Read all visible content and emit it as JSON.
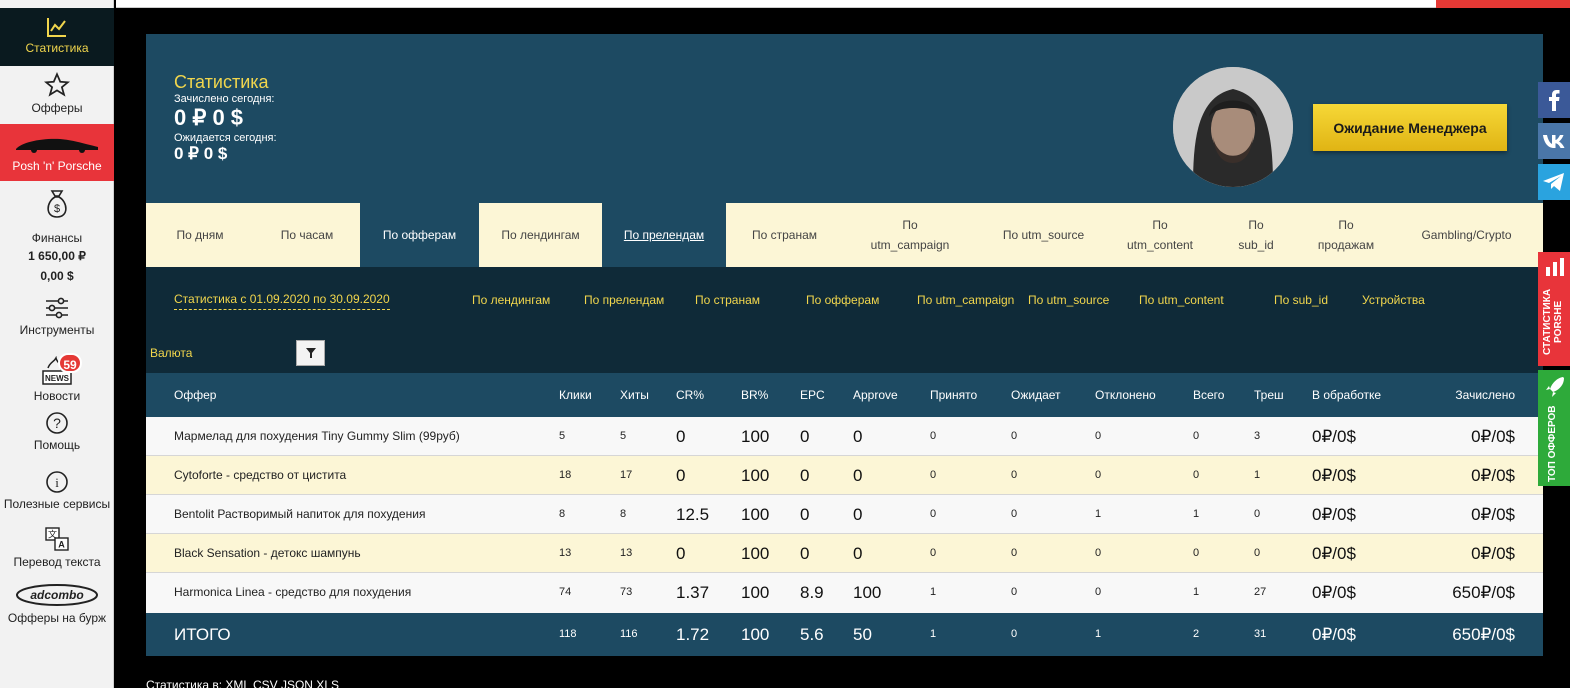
{
  "sidebar": {
    "items": [
      {
        "label": "Статистика",
        "icon": "chart-line-icon"
      },
      {
        "label": "Офферы",
        "icon": "star-icon"
      },
      {
        "label": "Posh 'n' Porsche",
        "icon": "sports-car-icon"
      },
      {
        "label": "Финансы",
        "icon": "money-bag-icon",
        "amount_rub": "1 650,00 ₽",
        "amount_usd": "0,00 $"
      },
      {
        "label": "Инструменты",
        "icon": "sliders-icon"
      },
      {
        "label": "Новости",
        "icon": "news-icon",
        "badge": "59",
        "badge_text": "NEWS"
      },
      {
        "label": "Помощь",
        "icon": "question-icon"
      },
      {
        "label": "Полезные сервисы",
        "icon": "info-icon"
      },
      {
        "label": "Перевод текста",
        "icon": "translate-icon"
      },
      {
        "label": "Офферы на бурж",
        "icon": "adcombo-logo-icon",
        "logo_text": "adcombo"
      }
    ]
  },
  "header": {
    "title": "Статистика",
    "credited_label": "Зачислено сегодня:",
    "credited_value": "0 ₽ 0 $",
    "expected_label": "Ожидается сегодня:",
    "expected_value": "0 ₽ 0 $",
    "manager_button": "Ожидание Менеджера"
  },
  "tabs": [
    {
      "label": "По дням"
    },
    {
      "label": "По часам"
    },
    {
      "label": "По офферам"
    },
    {
      "label": "По лендингам"
    },
    {
      "label": "По прелендам"
    },
    {
      "label": "По странам"
    },
    {
      "label": "По\nutm_campaign"
    },
    {
      "label": "По utm_source"
    },
    {
      "label": "По\nutm_content"
    },
    {
      "label": "По\nsub_id"
    },
    {
      "label": "По\nпродажам"
    },
    {
      "label": "Gambling/Crypto"
    }
  ],
  "active_tab": "По офферам",
  "subfilters": {
    "date_range": "Статистика с 01.09.2020 по 30.09.2020",
    "links": [
      "По лендингам",
      "По прелендам",
      "По странам",
      "По офферам",
      "По utm_campaign",
      "По utm_source",
      "По utm_content",
      "По sub_id",
      "Устройства"
    ],
    "currency_label": "Валюта"
  },
  "table": {
    "headers": [
      "Оффер",
      "Клики",
      "Хиты",
      "CR%",
      "BR%",
      "EPC",
      "Approve",
      "Принято",
      "Ожидает",
      "Отклонено",
      "Всего",
      "Треш",
      "В обработке",
      "Зачислено"
    ],
    "rows": [
      [
        "Мармелад для похудения Tiny Gummy Slim (99руб)",
        "5",
        "5",
        "0",
        "100",
        "0",
        "0",
        "0",
        "0",
        "0",
        "0",
        "3",
        "0₽/0$",
        "0₽/0$"
      ],
      [
        "Cytoforte - средство от цистита",
        "18",
        "17",
        "0",
        "100",
        "0",
        "0",
        "0",
        "0",
        "0",
        "0",
        "1",
        "0₽/0$",
        "0₽/0$"
      ],
      [
        "Bentolit Растворимый напиток для похудения",
        "8",
        "8",
        "12.5",
        "100",
        "0",
        "0",
        "0",
        "0",
        "1",
        "1",
        "0",
        "0₽/0$",
        "0₽/0$"
      ],
      [
        "Black Sensation - детокс шампунь",
        "13",
        "13",
        "0",
        "100",
        "0",
        "0",
        "0",
        "0",
        "0",
        "0",
        "0",
        "0₽/0$",
        "0₽/0$"
      ],
      [
        "Harmonica Linea - средство для похудения",
        "74",
        "73",
        "1.37",
        "100",
        "8.9",
        "100",
        "1",
        "0",
        "0",
        "1",
        "27",
        "0₽/0$",
        "650₽/0$"
      ]
    ],
    "total": [
      "ИТОГО",
      "118",
      "116",
      "1.72",
      "100",
      "5.6",
      "50",
      "1",
      "0",
      "1",
      "2",
      "31",
      "0₽/0$",
      "650₽/0$"
    ]
  },
  "right_widgets": {
    "social": [
      "facebook-icon",
      "vk-icon",
      "telegram-icon"
    ],
    "stats_tab": "СТАТИСТИКА PORSHE",
    "top_tab": "ТОП ОФФЕРОВ"
  },
  "footer": {
    "text": "Статистика в: XML CSV JSON XLS"
  },
  "colors": {
    "panel": "#1d4a62",
    "dark": "#0f2a38",
    "accent": "#f1d64d",
    "tab_bg": "#fcf6d6",
    "red": "#e8343a",
    "green": "#2eaa3a"
  }
}
